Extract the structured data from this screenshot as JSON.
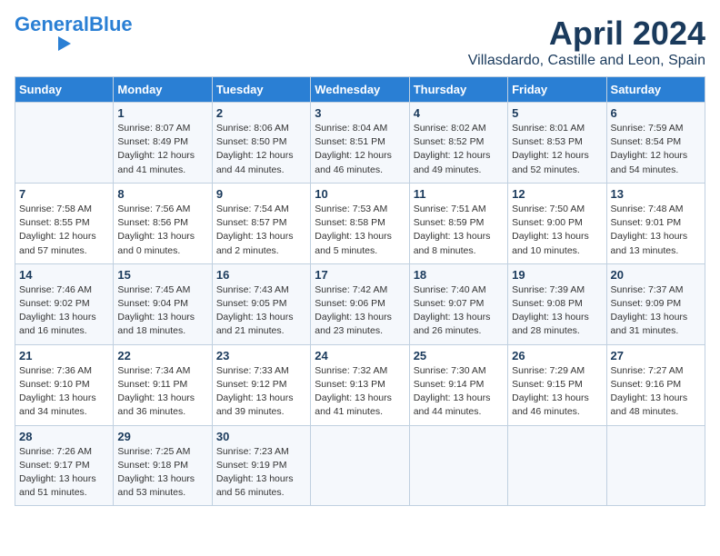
{
  "logo": {
    "part1": "General",
    "part2": "Blue"
  },
  "title": "April 2024",
  "subtitle": "Villasdardo, Castille and Leon, Spain",
  "weekdays": [
    "Sunday",
    "Monday",
    "Tuesday",
    "Wednesday",
    "Thursday",
    "Friday",
    "Saturday"
  ],
  "weeks": [
    [
      {
        "day": "",
        "info": ""
      },
      {
        "day": "1",
        "info": "Sunrise: 8:07 AM\nSunset: 8:49 PM\nDaylight: 12 hours\nand 41 minutes."
      },
      {
        "day": "2",
        "info": "Sunrise: 8:06 AM\nSunset: 8:50 PM\nDaylight: 12 hours\nand 44 minutes."
      },
      {
        "day": "3",
        "info": "Sunrise: 8:04 AM\nSunset: 8:51 PM\nDaylight: 12 hours\nand 46 minutes."
      },
      {
        "day": "4",
        "info": "Sunrise: 8:02 AM\nSunset: 8:52 PM\nDaylight: 12 hours\nand 49 minutes."
      },
      {
        "day": "5",
        "info": "Sunrise: 8:01 AM\nSunset: 8:53 PM\nDaylight: 12 hours\nand 52 minutes."
      },
      {
        "day": "6",
        "info": "Sunrise: 7:59 AM\nSunset: 8:54 PM\nDaylight: 12 hours\nand 54 minutes."
      }
    ],
    [
      {
        "day": "7",
        "info": "Sunrise: 7:58 AM\nSunset: 8:55 PM\nDaylight: 12 hours\nand 57 minutes."
      },
      {
        "day": "8",
        "info": "Sunrise: 7:56 AM\nSunset: 8:56 PM\nDaylight: 13 hours\nand 0 minutes."
      },
      {
        "day": "9",
        "info": "Sunrise: 7:54 AM\nSunset: 8:57 PM\nDaylight: 13 hours\nand 2 minutes."
      },
      {
        "day": "10",
        "info": "Sunrise: 7:53 AM\nSunset: 8:58 PM\nDaylight: 13 hours\nand 5 minutes."
      },
      {
        "day": "11",
        "info": "Sunrise: 7:51 AM\nSunset: 8:59 PM\nDaylight: 13 hours\nand 8 minutes."
      },
      {
        "day": "12",
        "info": "Sunrise: 7:50 AM\nSunset: 9:00 PM\nDaylight: 13 hours\nand 10 minutes."
      },
      {
        "day": "13",
        "info": "Sunrise: 7:48 AM\nSunset: 9:01 PM\nDaylight: 13 hours\nand 13 minutes."
      }
    ],
    [
      {
        "day": "14",
        "info": "Sunrise: 7:46 AM\nSunset: 9:02 PM\nDaylight: 13 hours\nand 16 minutes."
      },
      {
        "day": "15",
        "info": "Sunrise: 7:45 AM\nSunset: 9:04 PM\nDaylight: 13 hours\nand 18 minutes."
      },
      {
        "day": "16",
        "info": "Sunrise: 7:43 AM\nSunset: 9:05 PM\nDaylight: 13 hours\nand 21 minutes."
      },
      {
        "day": "17",
        "info": "Sunrise: 7:42 AM\nSunset: 9:06 PM\nDaylight: 13 hours\nand 23 minutes."
      },
      {
        "day": "18",
        "info": "Sunrise: 7:40 AM\nSunset: 9:07 PM\nDaylight: 13 hours\nand 26 minutes."
      },
      {
        "day": "19",
        "info": "Sunrise: 7:39 AM\nSunset: 9:08 PM\nDaylight: 13 hours\nand 28 minutes."
      },
      {
        "day": "20",
        "info": "Sunrise: 7:37 AM\nSunset: 9:09 PM\nDaylight: 13 hours\nand 31 minutes."
      }
    ],
    [
      {
        "day": "21",
        "info": "Sunrise: 7:36 AM\nSunset: 9:10 PM\nDaylight: 13 hours\nand 34 minutes."
      },
      {
        "day": "22",
        "info": "Sunrise: 7:34 AM\nSunset: 9:11 PM\nDaylight: 13 hours\nand 36 minutes."
      },
      {
        "day": "23",
        "info": "Sunrise: 7:33 AM\nSunset: 9:12 PM\nDaylight: 13 hours\nand 39 minutes."
      },
      {
        "day": "24",
        "info": "Sunrise: 7:32 AM\nSunset: 9:13 PM\nDaylight: 13 hours\nand 41 minutes."
      },
      {
        "day": "25",
        "info": "Sunrise: 7:30 AM\nSunset: 9:14 PM\nDaylight: 13 hours\nand 44 minutes."
      },
      {
        "day": "26",
        "info": "Sunrise: 7:29 AM\nSunset: 9:15 PM\nDaylight: 13 hours\nand 46 minutes."
      },
      {
        "day": "27",
        "info": "Sunrise: 7:27 AM\nSunset: 9:16 PM\nDaylight: 13 hours\nand 48 minutes."
      }
    ],
    [
      {
        "day": "28",
        "info": "Sunrise: 7:26 AM\nSunset: 9:17 PM\nDaylight: 13 hours\nand 51 minutes."
      },
      {
        "day": "29",
        "info": "Sunrise: 7:25 AM\nSunset: 9:18 PM\nDaylight: 13 hours\nand 53 minutes."
      },
      {
        "day": "30",
        "info": "Sunrise: 7:23 AM\nSunset: 9:19 PM\nDaylight: 13 hours\nand 56 minutes."
      },
      {
        "day": "",
        "info": ""
      },
      {
        "day": "",
        "info": ""
      },
      {
        "day": "",
        "info": ""
      },
      {
        "day": "",
        "info": ""
      }
    ]
  ]
}
